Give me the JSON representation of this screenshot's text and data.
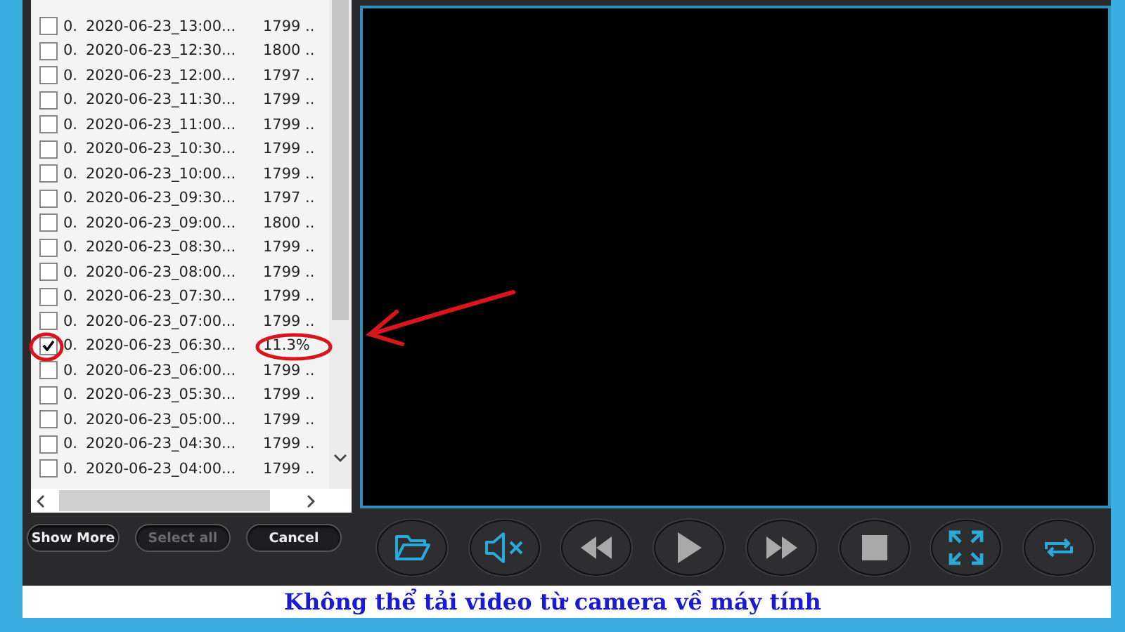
{
  "file_list": {
    "rows": [
      {
        "index": "0.",
        "name": "2020-06-23_13:00...",
        "size": "1799 ..",
        "checked": false
      },
      {
        "index": "0.",
        "name": "2020-06-23_12:30...",
        "size": "1800 ..",
        "checked": false
      },
      {
        "index": "0.",
        "name": "2020-06-23_12:00...",
        "size": "1797 ..",
        "checked": false
      },
      {
        "index": "0.",
        "name": "2020-06-23_11:30...",
        "size": "1799 ..",
        "checked": false
      },
      {
        "index": "0.",
        "name": "2020-06-23_11:00...",
        "size": "1799 ..",
        "checked": false
      },
      {
        "index": "0.",
        "name": "2020-06-23_10:30...",
        "size": "1799 ..",
        "checked": false
      },
      {
        "index": "0.",
        "name": "2020-06-23_10:00...",
        "size": "1799 ..",
        "checked": false
      },
      {
        "index": "0.",
        "name": "2020-06-23_09:30...",
        "size": "1797 ..",
        "checked": false
      },
      {
        "index": "0.",
        "name": "2020-06-23_09:00...",
        "size": "1800 ..",
        "checked": false
      },
      {
        "index": "0.",
        "name": "2020-06-23_08:30...",
        "size": "1799 ..",
        "checked": false
      },
      {
        "index": "0.",
        "name": "2020-06-23_08:00...",
        "size": "1799 ..",
        "checked": false
      },
      {
        "index": "0.",
        "name": "2020-06-23_07:30...",
        "size": "1799 ..",
        "checked": false
      },
      {
        "index": "0.",
        "name": "2020-06-23_07:00...",
        "size": "1799 ..",
        "checked": false
      },
      {
        "index": "0.",
        "name": "2020-06-23_06:30...",
        "size": "11.3%",
        "checked": true
      },
      {
        "index": "0.",
        "name": "2020-06-23_06:00...",
        "size": "1799 ..",
        "checked": false
      },
      {
        "index": "0.",
        "name": "2020-06-23_05:30...",
        "size": "1799 ..",
        "checked": false
      },
      {
        "index": "0.",
        "name": "2020-06-23_05:00...",
        "size": "1799 ..",
        "checked": false
      },
      {
        "index": "0.",
        "name": "2020-06-23_04:30...",
        "size": "1799 ..",
        "checked": false
      },
      {
        "index": "0.",
        "name": "2020-06-23_04:00...",
        "size": "1799 ..",
        "checked": false
      }
    ]
  },
  "buttons": [
    {
      "label": "Show More",
      "disabled": false
    },
    {
      "label": "Select all",
      "disabled": true
    },
    {
      "label": "Cancel",
      "disabled": false
    }
  ],
  "player": {
    "controls": [
      {
        "kind": "open"
      },
      {
        "kind": "mute"
      },
      {
        "kind": "rewind"
      },
      {
        "kind": "play"
      },
      {
        "kind": "forward"
      },
      {
        "kind": "stop"
      },
      {
        "kind": "fullscreen"
      },
      {
        "kind": "repeat"
      }
    ]
  },
  "caption": "Không thể tải video từ camera về máy tính"
}
